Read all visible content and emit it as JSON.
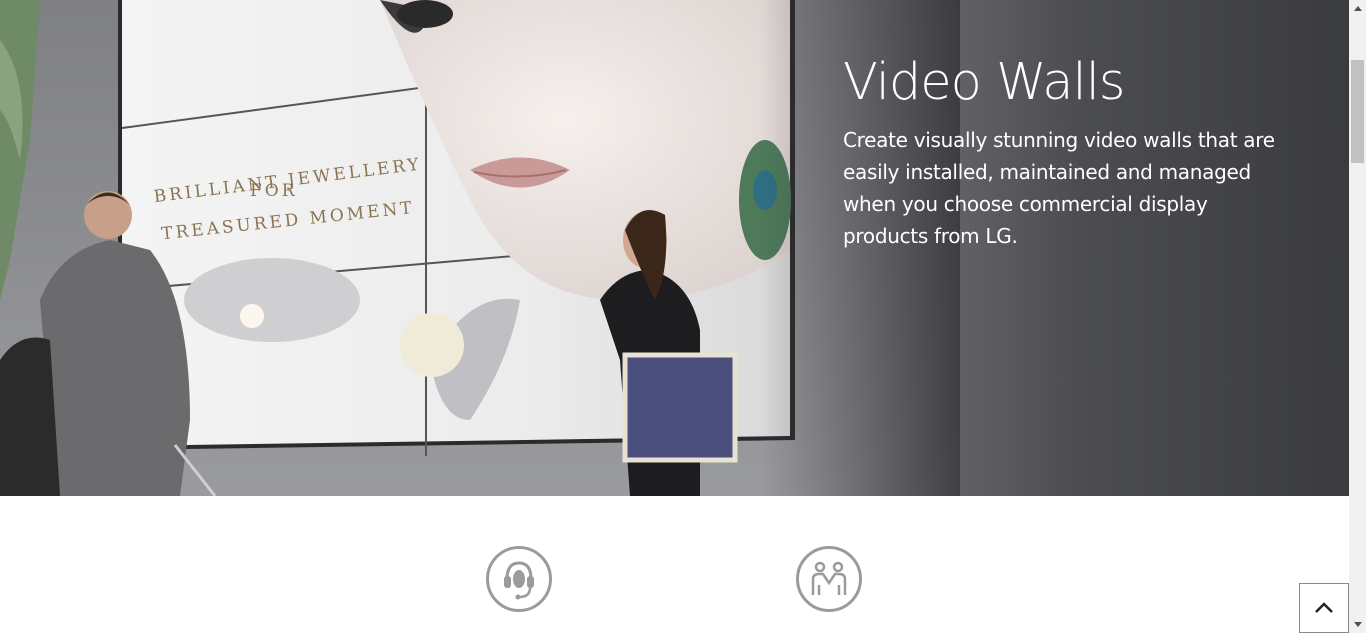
{
  "hero": {
    "title": "Video Walls",
    "description": "Create visually stunning video walls that are easily installed, maintained and managed when you choose commercial display products from LG.",
    "wall_text_line1": "BRILLIANT JEWELLERY",
    "wall_text_line2": "FOR",
    "wall_text_line3": "TREASURED MOMENT"
  },
  "icons": {
    "support": "headset-icon",
    "partner": "handshake-people-icon",
    "back_to_top": "chevron-up-icon"
  },
  "colors": {
    "hero_text": "#ffffff",
    "icon_stroke": "#9b9b9b",
    "hero_dark": "#3a3b3f"
  }
}
